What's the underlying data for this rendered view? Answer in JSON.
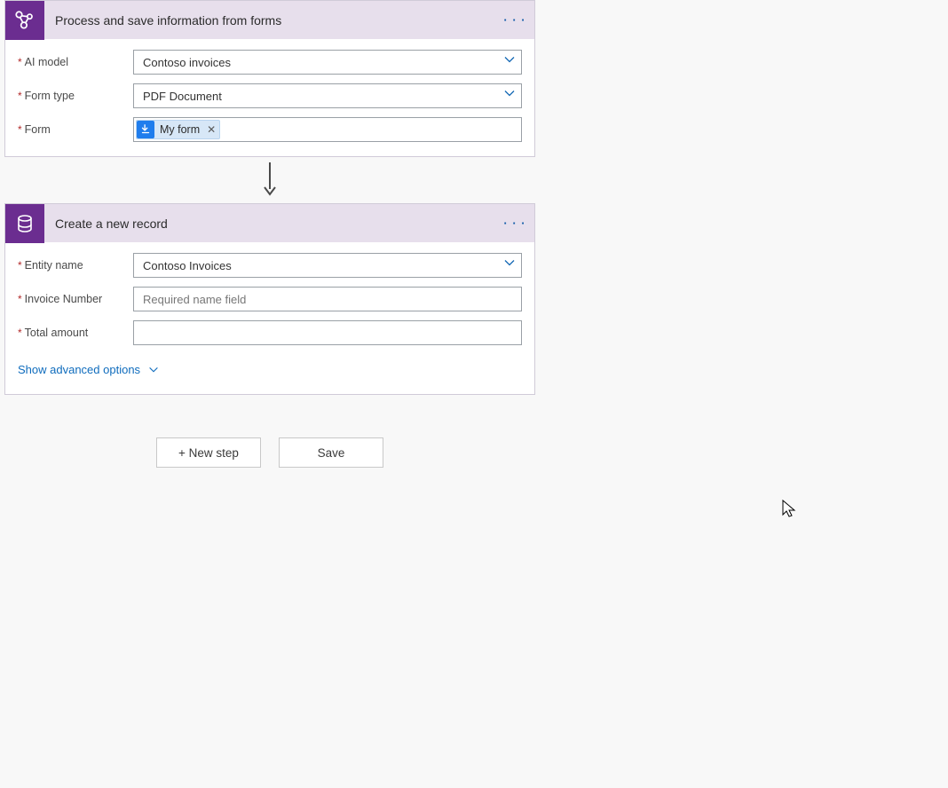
{
  "card1": {
    "title": "Process and save information from forms",
    "fields": {
      "ai_model": {
        "label": "AI model",
        "value": "Contoso invoices"
      },
      "form_type": {
        "label": "Form type",
        "value": "PDF Document"
      },
      "form": {
        "label": "Form",
        "token": "My form"
      }
    }
  },
  "card2": {
    "title": "Create a new record",
    "fields": {
      "entity_name": {
        "label": "Entity name",
        "value": "Contoso Invoices"
      },
      "invoice_number": {
        "label": "Invoice Number",
        "placeholder": "Required name field"
      },
      "total_amount": {
        "label": "Total amount",
        "value": ""
      }
    },
    "advanced_link": "Show advanced options"
  },
  "buttons": {
    "new_step": "+ New step",
    "save": "Save"
  }
}
